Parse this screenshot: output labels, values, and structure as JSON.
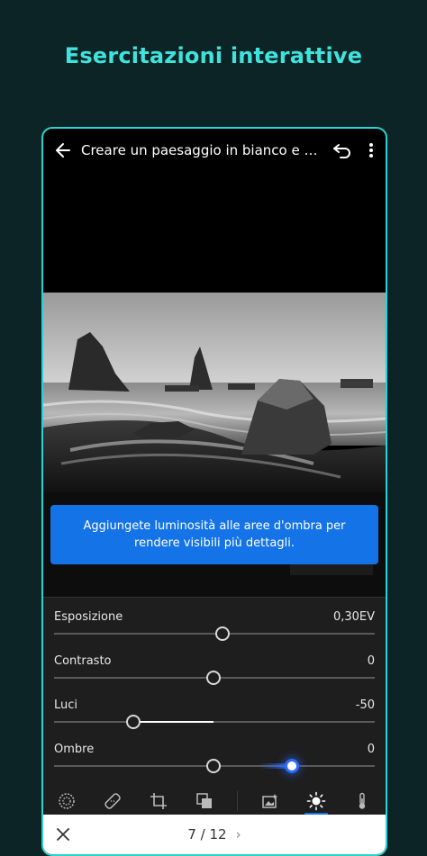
{
  "headline": "Esercitazioni interattive",
  "app": {
    "title": "Creare un paesaggio in bianco e ne...",
    "tooltip": "Aggiungete luminosità alle aree d'ombra per rendere visibili più dettagli.",
    "sliders": [
      {
        "label": "Esposizione",
        "value": "0,30EV",
        "position": 0.53
      },
      {
        "label": "Contrasto",
        "value": "0",
        "position": 0.5
      },
      {
        "label": "Luci",
        "value": "-50",
        "position": 0.25
      },
      {
        "label": "Ombre",
        "value": "0",
        "position": 0.5
      }
    ],
    "tools": [
      "presets-icon",
      "healing-icon",
      "crop-icon",
      "masking-icon",
      "photo-icon",
      "light-icon",
      "color-temp-icon"
    ],
    "pager": {
      "current": "7",
      "total": "12",
      "text": "7 / 12"
    }
  }
}
